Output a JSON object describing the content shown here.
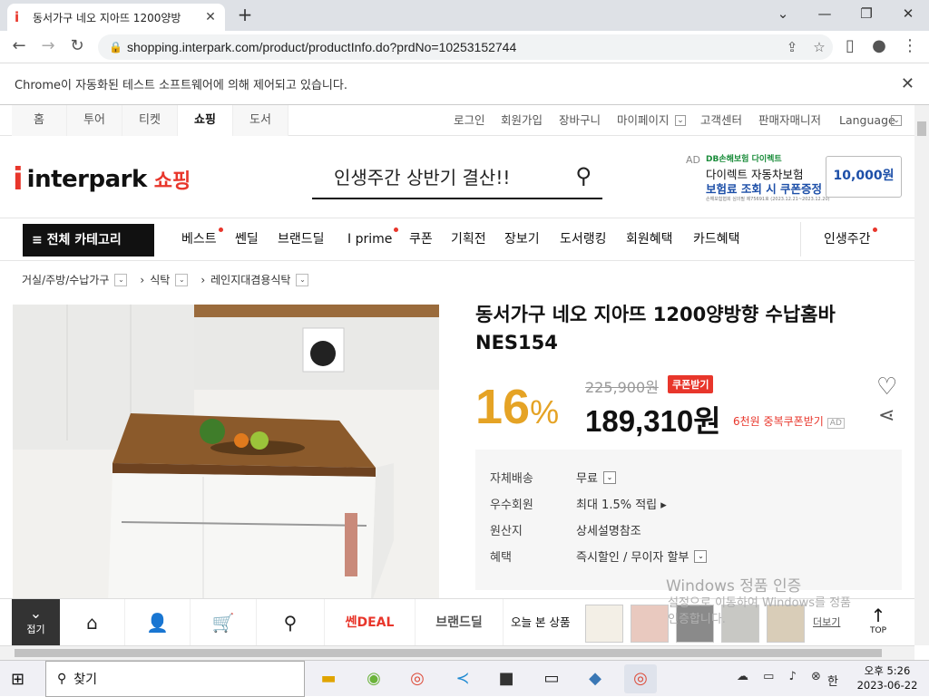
{
  "browser": {
    "tab_title": "동서가구 네오 지아뜨 1200양방",
    "url": "shopping.interpark.com/product/productInfo.do?prdNo=10253152744",
    "infobar": "Chrome이 자동화된 테스트 소프트웨어에 의해 제어되고 있습니다."
  },
  "topnav": {
    "tabs": [
      "홈",
      "투어",
      "티켓",
      "쇼핑",
      "도서"
    ],
    "selected": "쇼핑",
    "right": [
      "로그인",
      "회원가입",
      "장바구니",
      "마이페이지",
      "고객센터",
      "판매자매니저",
      "Language"
    ]
  },
  "header": {
    "logo": "interpark",
    "logo_sub": "쇼핑",
    "search_query": "인생주간 상반기 결산!!",
    "ad": {
      "label": "AD",
      "brand": "DB손해보험 다이렉트",
      "line1": "다이렉트 자동차보험",
      "line2": "보험료 조회 시 쿠폰증정",
      "fine": "손해보험협회 심의필 제75691호 (2023.12.21~2023.12.20)",
      "coupon": "10,000원"
    }
  },
  "catbar": {
    "all": "≡ 전체 카테고리",
    "items": [
      "베스트",
      "쎈딜",
      "브랜드딜",
      "I prime",
      "쿠폰",
      "기획전",
      "장보기",
      "도서랭킹",
      "회원혜택",
      "카드혜택"
    ],
    "right": "인생주간"
  },
  "breadcrumb": [
    "거실/주방/수납가구",
    "식탁",
    "레인지대겸용식탁"
  ],
  "product": {
    "title": "동서가구 네오 지아뜨 1200양방향 수납홈바 NES154",
    "discount": "16",
    "discount_unit": "%",
    "original_price": "225,900원",
    "coupon_button": "쿠폰받기",
    "price": "189,310원",
    "dup_coupon": "6천원 중복쿠폰받기",
    "ad_tag": "AD",
    "info": [
      {
        "k": "자체배송",
        "v": "무료"
      },
      {
        "k": "우수회원",
        "v": "최대 1.5% 적립 ▸"
      },
      {
        "k": "원산지",
        "v": "상세설명참조"
      },
      {
        "k": "혜택",
        "v": "즉시할인 / 무이자 할부"
      }
    ]
  },
  "watermark": {
    "line1": "Windows 정품 인증",
    "line2": "설정으로 이동하여 Windows를 정품",
    "line3": "인증합니다."
  },
  "dock": {
    "fold": "접기",
    "sendeal": "쎈DEAL",
    "branddeal": "브랜드딜",
    "recent": "오늘 본 상품",
    "more": "더보기",
    "top": "TOP"
  },
  "taskbar": {
    "search": "찾기",
    "ime": "한",
    "time": "오후 5:26",
    "date": "2023-06-22"
  }
}
